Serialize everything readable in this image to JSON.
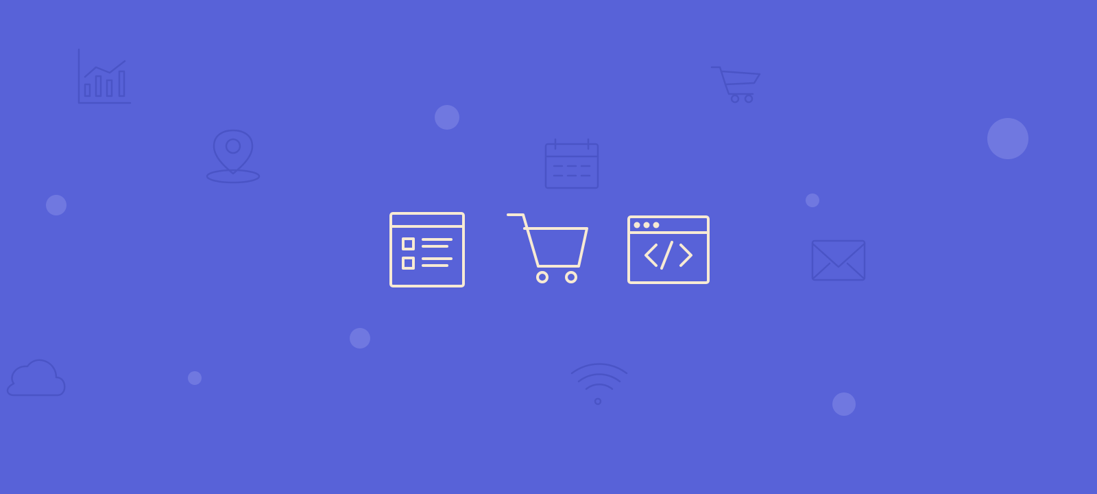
{
  "colors": {
    "background": "#5862d8",
    "featured_icon_stroke": "#f7ead3",
    "background_icon_stroke": "#3f49b8",
    "bubble_fill": "#7880e3"
  },
  "background_icons": [
    "bar-chart-icon",
    "map-pin-icon",
    "calendar-icon",
    "shopping-cart-icon",
    "mail-icon",
    "cloud-icon",
    "wifi-icon"
  ],
  "featured_icons": [
    "browser-list-icon",
    "shopping-cart-icon",
    "code-window-icon"
  ]
}
